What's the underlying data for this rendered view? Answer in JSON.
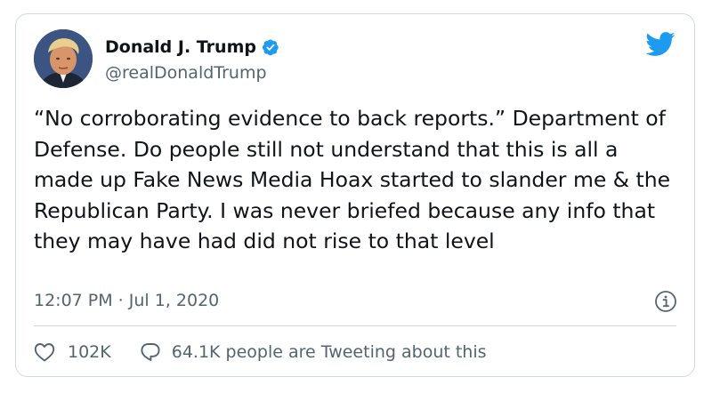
{
  "tweet": {
    "author": {
      "display_name": "Donald J. Trump",
      "handle": "@realDonaldTrump",
      "verified": true,
      "avatar_icon": "profile-photo"
    },
    "text": "“No corroborating evidence to back reports.” Department of Defense. Do people still not understand that this is all a made up Fake News Media Hoax started to slander me & the Republican Party. I was never briefed because any info that they may have had did not rise to that level",
    "timestamp": "12:07 PM · Jul 1, 2020",
    "likes": "102K",
    "conversation": "64.1K people are Tweeting about this"
  },
  "icons": {
    "brand": "twitter-bird-icon",
    "verified": "verified-badge-icon",
    "info": "info-icon",
    "like": "heart-icon",
    "reply": "speech-bubble-icon"
  },
  "colors": {
    "brand_blue": "#1d9bf0",
    "text": "#0f1419",
    "secondary_text": "#536471",
    "border": "#cfd9de"
  }
}
